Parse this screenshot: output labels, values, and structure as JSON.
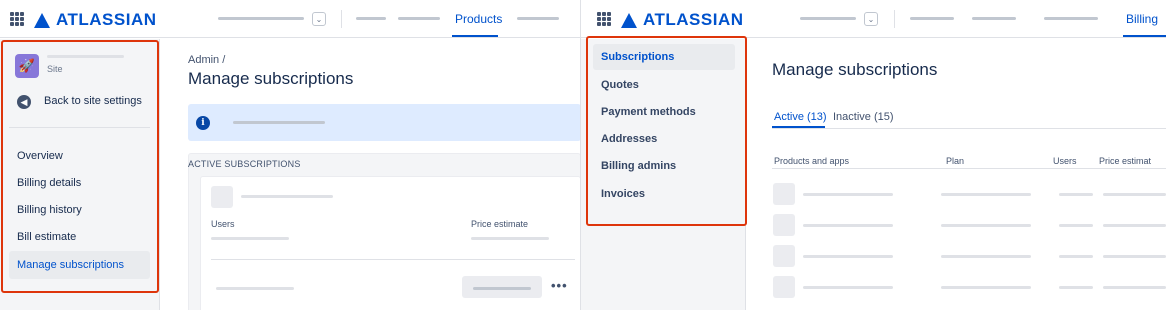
{
  "left": {
    "brand": "ATLASSIAN",
    "topnav_active": "Products",
    "sidebar": {
      "site_label": "Site",
      "back_label": "Back to site settings",
      "items": [
        {
          "label": "Overview"
        },
        {
          "label": "Billing details"
        },
        {
          "label": "Billing history"
        },
        {
          "label": "Bill estimate"
        },
        {
          "label": "Manage subscriptions"
        }
      ]
    },
    "breadcrumb": "Admin  /",
    "title": "Manage subscriptions",
    "section_title": "ACTIVE SUBSCRIPTIONS",
    "users_label": "Users",
    "price_label": "Price estimate",
    "more_label": "•••"
  },
  "right": {
    "brand": "ATLASSIAN",
    "topnav_active": "Billing",
    "sidebar": {
      "items": [
        {
          "label": "Subscriptions"
        },
        {
          "label": "Quotes"
        },
        {
          "label": "Payment methods"
        },
        {
          "label": "Addresses"
        },
        {
          "label": "Billing admins"
        },
        {
          "label": "Invoices"
        }
      ]
    },
    "title": "Manage subscriptions",
    "tabs": [
      {
        "label": "Active (13)"
      },
      {
        "label": "Inactive (15)"
      }
    ],
    "columns": [
      "Products and apps",
      "Plan",
      "Users",
      "Price estimat"
    ]
  },
  "colors": {
    "accent": "#0052cc",
    "highlight": "#de350b",
    "info": "#deebff"
  },
  "icons": {
    "grid": "app-switcher-icon",
    "logo": "atlassian-logo-icon",
    "back": "back-arrow-icon",
    "info": "info-icon",
    "site": "rocket-site-icon"
  }
}
